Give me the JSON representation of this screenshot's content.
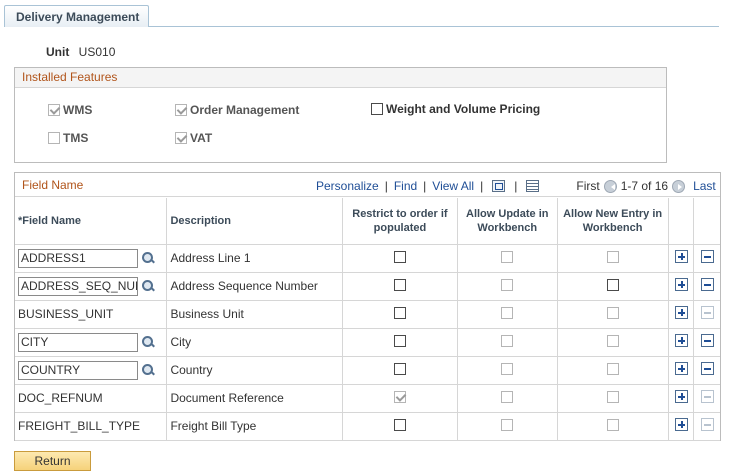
{
  "tabs": [
    {
      "label": "Delivery Management"
    }
  ],
  "unit": {
    "label": "Unit",
    "value": "US010"
  },
  "installed_features": {
    "title": "Installed Features",
    "items": [
      {
        "label": "WMS",
        "checked": true,
        "enabled": false
      },
      {
        "label": "Order Management",
        "checked": true,
        "enabled": false
      },
      {
        "label": "Weight and Volume Pricing",
        "checked": false,
        "enabled": true
      },
      {
        "label": "TMS",
        "checked": false,
        "enabled": false
      },
      {
        "label": "VAT",
        "checked": true,
        "enabled": false
      }
    ]
  },
  "grid": {
    "title": "Field Name",
    "nav": {
      "personalize": "Personalize",
      "find": "Find",
      "view_all": "View All",
      "first": "First",
      "range": "1-7 of 16",
      "last": "Last"
    },
    "columns": {
      "field_name": "*Field Name",
      "description": "Description",
      "restrict": "Restrict to order if populated",
      "allow_update": "Allow Update in Workbench",
      "allow_new": "Allow New Entry in Workbench"
    },
    "rows": [
      {
        "field_name": "ADDRESS1",
        "editable": true,
        "description": "Address Line 1"
      },
      {
        "field_name": "ADDRESS_SEQ_NUM",
        "editable": true,
        "description": "Address Sequence Number"
      },
      {
        "field_name": "BUSINESS_UNIT",
        "editable": false,
        "description": "Business Unit"
      },
      {
        "field_name": "CITY",
        "editable": true,
        "description": "City"
      },
      {
        "field_name": "COUNTRY",
        "editable": true,
        "description": "Country"
      },
      {
        "field_name": "DOC_REFNUM",
        "editable": false,
        "description": "Document Reference"
      },
      {
        "field_name": "FREIGHT_BILL_TYPE",
        "editable": false,
        "description": "Freight Bill Type"
      }
    ]
  },
  "buttons": {
    "return": "Return"
  }
}
